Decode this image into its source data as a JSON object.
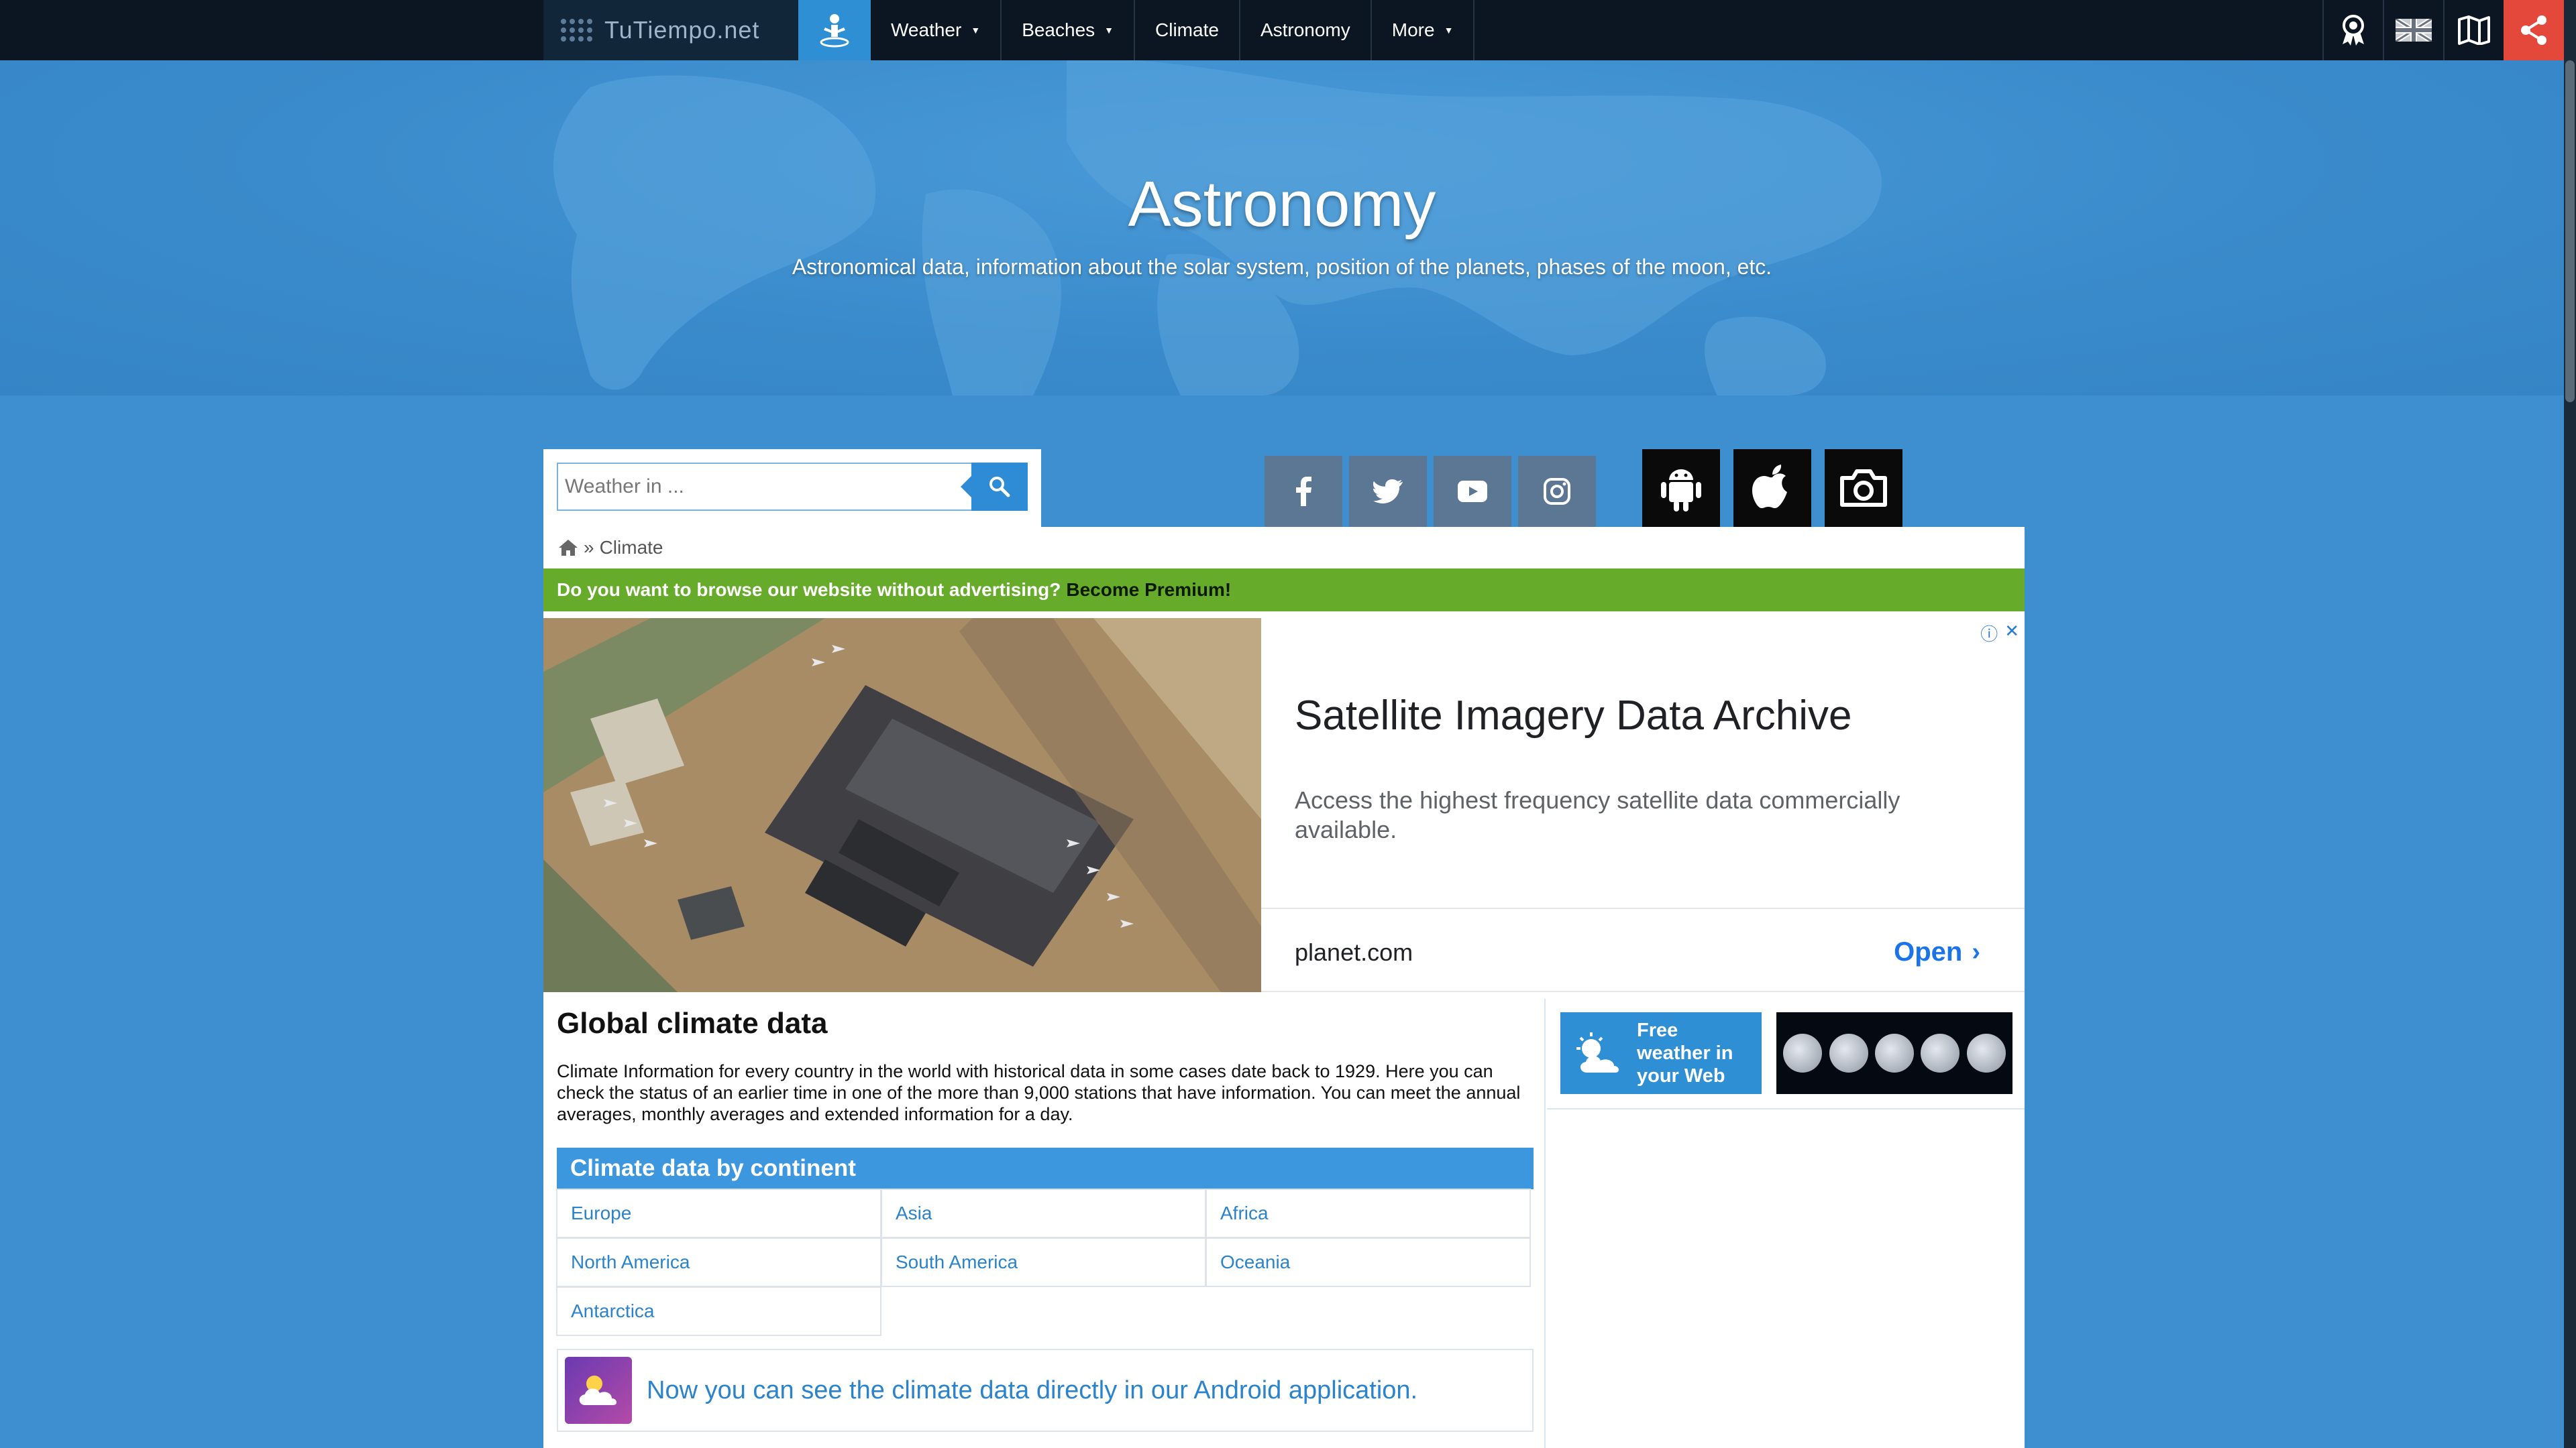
{
  "brand": {
    "name": "TuTiempo.net"
  },
  "nav": {
    "items": [
      {
        "label": "Weather",
        "dropdown": true
      },
      {
        "label": "Beaches",
        "dropdown": true
      },
      {
        "label": "Climate",
        "dropdown": false
      },
      {
        "label": "Astronomy",
        "dropdown": false
      },
      {
        "label": "More",
        "dropdown": true
      }
    ],
    "right_icons": [
      "award-icon",
      "uk-flag-icon",
      "map-book-icon",
      "share-icon"
    ]
  },
  "hero": {
    "title": "Astronomy",
    "subtitle": "Astronomical data, information about the solar system, position of the planets, phases of the moon, etc."
  },
  "search": {
    "placeholder": "Weather in ..."
  },
  "social": [
    "facebook-icon",
    "twitter-icon",
    "youtube-icon",
    "instagram-icon"
  ],
  "apps": [
    "android-icon",
    "apple-icon",
    "camera-icon"
  ],
  "breadcrumb": {
    "current": "Climate",
    "separator": "»"
  },
  "premium": {
    "text": "Do you want to browse our website without advertising?",
    "link": "Become Premium!"
  },
  "ad": {
    "title": "Satellite Imagery Data Archive",
    "description": "Access the highest frequency satellite data commercially available.",
    "domain": "planet.com",
    "cta": "Open"
  },
  "main": {
    "title": "Global climate data",
    "intro": "Climate Information for every country in the world with historical data in some cases date back to 1929. Here you can check the status of an earlier time in one of the more than 9,000 stations that have information. You can meet the annual averages, monthly averages and extended information for a day.",
    "continents_heading": "Climate data by continent",
    "continents": [
      [
        "Europe",
        "Asia",
        "Africa"
      ],
      [
        "North America",
        "South America",
        "Oceania"
      ],
      [
        "Antarctica"
      ]
    ],
    "android_note": "Now you can see the climate data directly in our Android application."
  },
  "sidebar": {
    "free_weather": [
      "Free",
      "weather in",
      "your Web"
    ]
  },
  "colors": {
    "topbar": "#0b1622",
    "accent_blue": "#2f8fd5",
    "premium_green": "#67ab2b",
    "share_red": "#e3483b"
  }
}
